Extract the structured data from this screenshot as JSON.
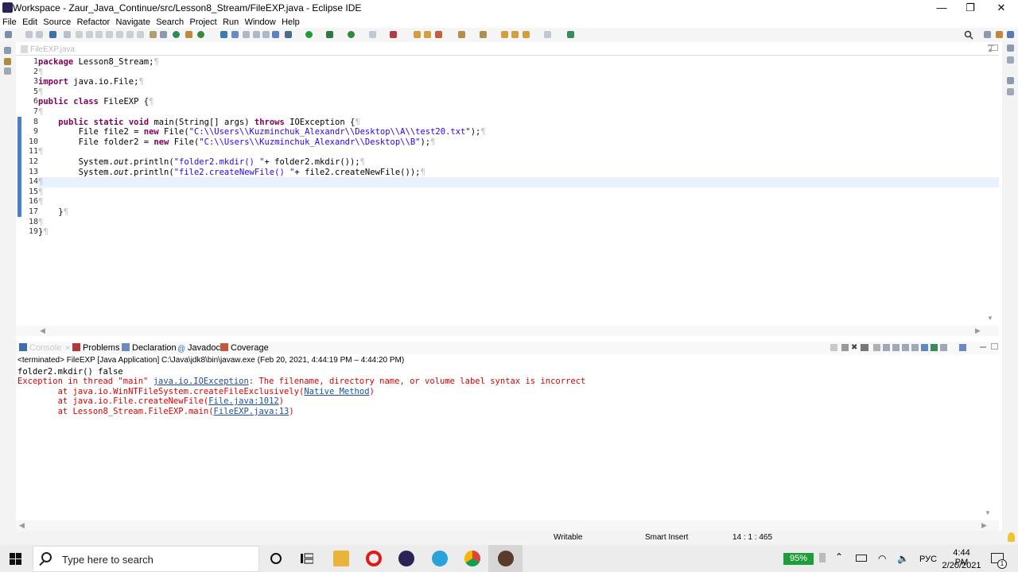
{
  "window": {
    "title": "Workspace - Zaur_Java_Continue/src/Lesson8_Stream/FileEXP.java - Eclipse IDE",
    "minimize": "—",
    "maximize": "❐",
    "close": "✕"
  },
  "menu": [
    "File",
    "Edit",
    "Source",
    "Refactor",
    "Navigate",
    "Search",
    "Project",
    "Run",
    "Window",
    "Help"
  ],
  "editor": {
    "tab_label": "FileEXP.java",
    "current_line": 14,
    "line_numbers": [
      "1",
      "2",
      "3",
      "5",
      "6",
      "7",
      "8",
      "9",
      "10",
      "11",
      "12",
      "13",
      "14",
      "15",
      "16",
      "17",
      "18",
      "19"
    ],
    "lines": [
      "package Lesson8_Stream;",
      "",
      "import java.io.File;",
      "",
      "public class FileEXP {",
      "",
      "    public static void main(String[] args) throws IOException {",
      "        File file2 = new File(\"C:\\\\Users\\\\Kuzminchuk_Alexandr\\\\Desktop\\\\A\\\\test20.txt\");",
      "        File folder2 = new File(\"C:\\\\Users\\\\Kuzminchuk_Alexandr\\\\Desktop\\\\B\");",
      "",
      "        System.out.println(\"folder2.mkdir() \"+ folder2.mkdir());",
      "        System.out.println(\"file2.createNewFile() \"+ file2.createNewFile());",
      "",
      "",
      "",
      "    }",
      "",
      "}"
    ]
  },
  "console_panel": {
    "tabs": [
      {
        "label": "Console",
        "active": true
      },
      {
        "label": "Problems"
      },
      {
        "label": "Declaration"
      },
      {
        "label": "Javadoc"
      },
      {
        "label": "Coverage"
      }
    ],
    "status": "<terminated> FileEXP [Java Application] C:\\Java\\jdk8\\bin\\javaw.exe  (Feb 20, 2021, 4:44:19 PM – 4:44:20 PM)",
    "output": {
      "line1": "folder2.mkdir() false",
      "exc_prefix": "Exception in thread \"main\" ",
      "exc_class": "java.io.IOException",
      "exc_message": ": The filename, directory name, or volume label syntax is incorrect",
      "trace": [
        {
          "prefix": "\tat java.io.WinNTFileSystem.createFileExclusively(",
          "link": "Native Method",
          "suffix": ")"
        },
        {
          "prefix": "\tat java.io.File.createNewFile(",
          "link": "File.java:1012",
          "suffix": ")"
        },
        {
          "prefix": "\tat Lesson8_Stream.FileEXP.main(",
          "link": "FileEXP.java:13",
          "suffix": ")"
        }
      ]
    }
  },
  "statusbar": {
    "writable": "Writable",
    "insert_mode": "Smart Insert",
    "position": "14 : 1 : 465"
  },
  "taskbar": {
    "search_placeholder": "Type here to search",
    "battery": "95%",
    "language": "РУС",
    "time": "4:44 PM",
    "date": "2/20/2021",
    "notification_count": "1"
  },
  "colors": {
    "keyword": "#7f0055",
    "string": "#2a00ff",
    "error": "#e00000",
    "link": "#1c4fa3",
    "current_line": "#e8f2fe",
    "ruler_mark": "#4a7fcb",
    "battery_badge": "#1e9e3a"
  }
}
